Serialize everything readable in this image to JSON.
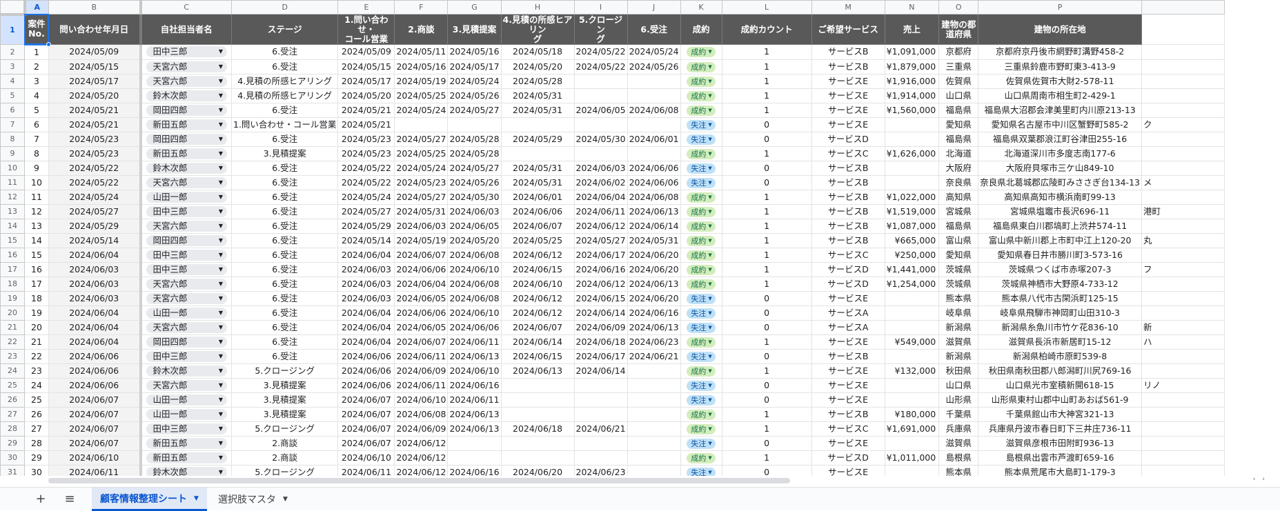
{
  "columns": [
    "A",
    "B",
    "C",
    "D",
    "E",
    "F",
    "G",
    "H",
    "I",
    "J",
    "K",
    "L",
    "M",
    "N",
    "O",
    "P",
    ""
  ],
  "selected_column": "A",
  "selected_row": "1",
  "headers": [
    "案件\nNo.",
    "問い合わせ年月日",
    "自社担当者名",
    "ステージ",
    "1.問い合わせ・\nコール営業",
    "2.商談",
    "3.見積提案",
    "4.見積の所感ヒアリン\nグ",
    "5.クロージン\nグ",
    "6.受注",
    "成約",
    "成約カウント",
    "ご希望サービス",
    "売上",
    "建物の都\n道府県",
    "建物の所在地",
    ""
  ],
  "rows": [
    [
      "1",
      "2024/05/09",
      "田中三郎",
      "6.受注",
      "2024/05/09",
      "2024/05/11",
      "2024/05/16",
      "2024/05/18",
      "2024/05/22",
      "2024/05/24",
      "成約",
      "1",
      "サービスB",
      "¥1,091,000",
      "京都府",
      "京都府京丹後市網野町溝野458-2",
      ""
    ],
    [
      "2",
      "2024/05/15",
      "天宮六郎",
      "6.受注",
      "2024/05/15",
      "2024/05/16",
      "2024/05/17",
      "2024/05/20",
      "2024/05/22",
      "2024/05/26",
      "成約",
      "1",
      "サービスB",
      "¥1,879,000",
      "三重県",
      "三重県鈴鹿市野町東3-413-9",
      ""
    ],
    [
      "3",
      "2024/05/17",
      "天宮六郎",
      "4.見積の所感ヒアリング",
      "2024/05/17",
      "2024/05/19",
      "2024/05/24",
      "2024/05/28",
      "",
      "",
      "成約",
      "1",
      "サービスE",
      "¥1,916,000",
      "佐賀県",
      "佐賀県佐賀市大財2-578-11",
      ""
    ],
    [
      "4",
      "2024/05/20",
      "鈴木次郎",
      "4.見積の所感ヒアリング",
      "2024/05/20",
      "2024/05/25",
      "2024/05/26",
      "2024/05/31",
      "",
      "",
      "成約",
      "1",
      "サービスE",
      "¥1,914,000",
      "山口県",
      "山口県周南市相生町2-429-1",
      ""
    ],
    [
      "5",
      "2024/05/21",
      "岡田四郎",
      "6.受注",
      "2024/05/21",
      "2024/05/24",
      "2024/05/27",
      "2024/05/31",
      "2024/06/05",
      "2024/06/08",
      "成約",
      "1",
      "サービスE",
      "¥1,560,000",
      "福島県",
      "福島県大沼郡会津美里町内川原213-13",
      ""
    ],
    [
      "6",
      "2024/05/21",
      "新田五郎",
      "1.問い合わせ・コール営業",
      "2024/05/21",
      "",
      "",
      "",
      "",
      "",
      "失注",
      "0",
      "サービスE",
      "",
      "愛知県",
      "愛知県名古屋市中川区蟹野町585-2",
      "ク"
    ],
    [
      "7",
      "2024/05/23",
      "岡田四郎",
      "6.受注",
      "2024/05/23",
      "2024/05/27",
      "2024/05/28",
      "2024/05/29",
      "2024/05/30",
      "2024/06/01",
      "失注",
      "0",
      "サービスD",
      "",
      "福島県",
      "福島県双葉郡浪江町谷津田255-16",
      ""
    ],
    [
      "8",
      "2024/05/23",
      "新田五郎",
      "3.見積提案",
      "2024/05/23",
      "2024/05/25",
      "2024/05/28",
      "",
      "",
      "",
      "成約",
      "1",
      "サービスC",
      "¥1,626,000",
      "北海道",
      "北海道深川市多度志南177-6",
      ""
    ],
    [
      "9",
      "2024/05/22",
      "鈴木次郎",
      "6.受注",
      "2024/05/22",
      "2024/05/24",
      "2024/05/27",
      "2024/05/31",
      "2024/06/03",
      "2024/06/06",
      "失注",
      "0",
      "サービスB",
      "",
      "大阪府",
      "大阪府貝塚市三ケ山849-10",
      ""
    ],
    [
      "10",
      "2024/05/22",
      "天宮六郎",
      "6.受注",
      "2024/05/22",
      "2024/05/23",
      "2024/05/26",
      "2024/05/31",
      "2024/06/02",
      "2024/06/06",
      "失注",
      "0",
      "サービスB",
      "",
      "奈良県",
      "奈良県北葛城郡広陵町みささぎ台134-13",
      "メ"
    ],
    [
      "11",
      "2024/05/24",
      "山田一郎",
      "6.受注",
      "2024/05/24",
      "2024/05/27",
      "2024/05/30",
      "2024/06/01",
      "2024/06/04",
      "2024/06/08",
      "成約",
      "1",
      "サービスB",
      "¥1,022,000",
      "高知県",
      "高知県高知市横浜南町99-13",
      ""
    ],
    [
      "12",
      "2024/05/27",
      "田中三郎",
      "6.受注",
      "2024/05/27",
      "2024/05/31",
      "2024/06/03",
      "2024/06/06",
      "2024/06/11",
      "2024/06/13",
      "成約",
      "1",
      "サービスB",
      "¥1,519,000",
      "宮城県",
      "宮城県塩竈市長沢696-11",
      "港町"
    ],
    [
      "13",
      "2024/05/29",
      "天宮六郎",
      "6.受注",
      "2024/05/29",
      "2024/06/03",
      "2024/06/05",
      "2024/06/07",
      "2024/06/12",
      "2024/06/14",
      "成約",
      "1",
      "サービスB",
      "¥1,087,000",
      "福島県",
      "福島県東白川郡塙町上渋井574-11",
      ""
    ],
    [
      "14",
      "2024/05/14",
      "岡田四郎",
      "6.受注",
      "2024/05/14",
      "2024/05/19",
      "2024/05/20",
      "2024/05/25",
      "2024/05/27",
      "2024/05/31",
      "成約",
      "1",
      "サービスB",
      "¥665,000",
      "富山県",
      "富山県中新川郡上市町中江上120-20",
      "丸"
    ],
    [
      "15",
      "2024/06/04",
      "田中三郎",
      "6.受注",
      "2024/06/04",
      "2024/06/07",
      "2024/06/08",
      "2024/06/12",
      "2024/06/17",
      "2024/06/20",
      "成約",
      "1",
      "サービスC",
      "¥250,000",
      "愛知県",
      "愛知県春日井市勝川町3-573-16",
      ""
    ],
    [
      "16",
      "2024/06/03",
      "田中三郎",
      "6.受注",
      "2024/06/03",
      "2024/06/06",
      "2024/06/10",
      "2024/06/15",
      "2024/06/16",
      "2024/06/20",
      "成約",
      "1",
      "サービスD",
      "¥1,441,000",
      "茨城県",
      "茨城県つくば市赤塚207-3",
      "フ"
    ],
    [
      "17",
      "2024/06/03",
      "天宮六郎",
      "6.受注",
      "2024/06/03",
      "2024/06/04",
      "2024/06/08",
      "2024/06/10",
      "2024/06/12",
      "2024/06/13",
      "成約",
      "1",
      "サービスD",
      "¥1,254,000",
      "茨城県",
      "茨城県神栖市大野原4-733-12",
      ""
    ],
    [
      "18",
      "2024/06/03",
      "天宮六郎",
      "6.受注",
      "2024/06/03",
      "2024/06/05",
      "2024/06/08",
      "2024/06/12",
      "2024/06/15",
      "2024/06/20",
      "失注",
      "0",
      "サービスE",
      "",
      "熊本県",
      "熊本県八代市古閑浜町125-15",
      ""
    ],
    [
      "19",
      "2024/06/04",
      "山田一郎",
      "6.受注",
      "2024/06/04",
      "2024/06/06",
      "2024/06/10",
      "2024/06/12",
      "2024/06/14",
      "2024/06/16",
      "失注",
      "0",
      "サービスA",
      "",
      "岐阜県",
      "岐阜県飛騨市神岡町山田310-3",
      ""
    ],
    [
      "20",
      "2024/06/04",
      "天宮六郎",
      "6.受注",
      "2024/06/04",
      "2024/06/05",
      "2024/06/06",
      "2024/06/07",
      "2024/06/09",
      "2024/06/13",
      "失注",
      "0",
      "サービスA",
      "",
      "新潟県",
      "新潟県糸魚川市竹ケ花836-10",
      "新"
    ],
    [
      "21",
      "2024/06/04",
      "岡田四郎",
      "6.受注",
      "2024/06/04",
      "2024/06/07",
      "2024/06/11",
      "2024/06/14",
      "2024/06/18",
      "2024/06/23",
      "成約",
      "1",
      "サービスE",
      "¥549,000",
      "滋賀県",
      "滋賀県長浜市新居町15-12",
      "ハ"
    ],
    [
      "22",
      "2024/06/06",
      "田中三郎",
      "6.受注",
      "2024/06/06",
      "2024/06/11",
      "2024/06/13",
      "2024/06/15",
      "2024/06/17",
      "2024/06/21",
      "失注",
      "0",
      "サービスB",
      "",
      "新潟県",
      "新潟県柏崎市原町539-8",
      ""
    ],
    [
      "23",
      "2024/06/06",
      "鈴木次郎",
      "5.クロージング",
      "2024/06/06",
      "2024/06/09",
      "2024/06/10",
      "2024/06/13",
      "2024/06/14",
      "",
      "成約",
      "1",
      "サービスE",
      "¥132,000",
      "秋田県",
      "秋田県南秋田郡八郎潟町川尻769-16",
      ""
    ],
    [
      "24",
      "2024/06/06",
      "天宮六郎",
      "3.見積提案",
      "2024/06/06",
      "2024/06/11",
      "2024/06/16",
      "",
      "",
      "",
      "失注",
      "0",
      "サービスE",
      "",
      "山口県",
      "山口県光市室積新開618-15",
      "リノ"
    ],
    [
      "25",
      "2024/06/07",
      "山田一郎",
      "3.見積提案",
      "2024/06/07",
      "2024/06/10",
      "2024/06/11",
      "",
      "",
      "",
      "失注",
      "0",
      "サービスE",
      "",
      "山形県",
      "山形県東村山郡中山町あおば561-9",
      ""
    ],
    [
      "26",
      "2024/06/07",
      "山田一郎",
      "3.見積提案",
      "2024/06/07",
      "2024/06/08",
      "2024/06/13",
      "",
      "",
      "",
      "成約",
      "1",
      "サービスB",
      "¥180,000",
      "千葉県",
      "千葉県館山市大神宮321-13",
      ""
    ],
    [
      "27",
      "2024/06/07",
      "田中三郎",
      "5.クロージング",
      "2024/06/07",
      "2024/06/09",
      "2024/06/13",
      "2024/06/18",
      "2024/06/21",
      "",
      "成約",
      "1",
      "サービスC",
      "¥1,691,000",
      "兵庫県",
      "兵庫県丹波市春日町下三井庄736-11",
      ""
    ],
    [
      "28",
      "2024/06/07",
      "新田五郎",
      "2.商談",
      "2024/06/07",
      "2024/06/12",
      "",
      "",
      "",
      "",
      "失注",
      "0",
      "サービスE",
      "",
      "滋賀県",
      "滋賀県彦根市田附町936-13",
      ""
    ],
    [
      "29",
      "2024/06/10",
      "新田五郎",
      "2.商談",
      "2024/06/10",
      "2024/06/12",
      "",
      "",
      "",
      "",
      "成約",
      "1",
      "サービスD",
      "¥1,011,000",
      "島根県",
      "島根県出雲市芦渡町659-16",
      ""
    ],
    [
      "30",
      "2024/06/11",
      "鈴木次郎",
      "5.クロージング",
      "2024/06/11",
      "2024/06/12",
      "2024/06/16",
      "2024/06/20",
      "2024/06/23",
      "",
      "失注",
      "0",
      "サービスE",
      "",
      "熊本県",
      "熊本県荒尾市大島町1-179-3",
      ""
    ]
  ],
  "status_colors": {
    "成約": "#d4edbc",
    "失注": "#bfe1f6"
  },
  "tabs": {
    "add_label": "+",
    "menu_label": "≡",
    "sheets": [
      {
        "label": "顧客情報整理シート",
        "active": true
      },
      {
        "label": "選択肢マスタ",
        "active": false
      }
    ]
  },
  "icons": {
    "dropdown": "triangle-down",
    "add": "plus",
    "list": "hamburger"
  }
}
